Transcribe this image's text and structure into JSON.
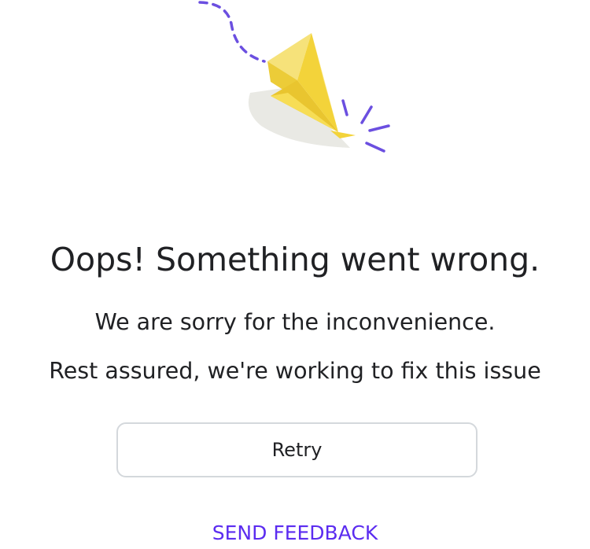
{
  "error_page": {
    "illustration_icon": "paper-airplane-icon",
    "title": "Oops! Something went wrong.",
    "subtitle_line1": "We are sorry for the inconvenience.",
    "subtitle_line2": "Rest assured, we're working to fix this issue",
    "retry_label": "Retry",
    "feedback_label": "SEND FEEDBACK"
  },
  "colors": {
    "text": "#202124",
    "link": "#5b2cf0",
    "button_border": "#d4d8dc",
    "dash_accent": "#6b4fe0",
    "plane_yellow": "#f5d94a"
  }
}
